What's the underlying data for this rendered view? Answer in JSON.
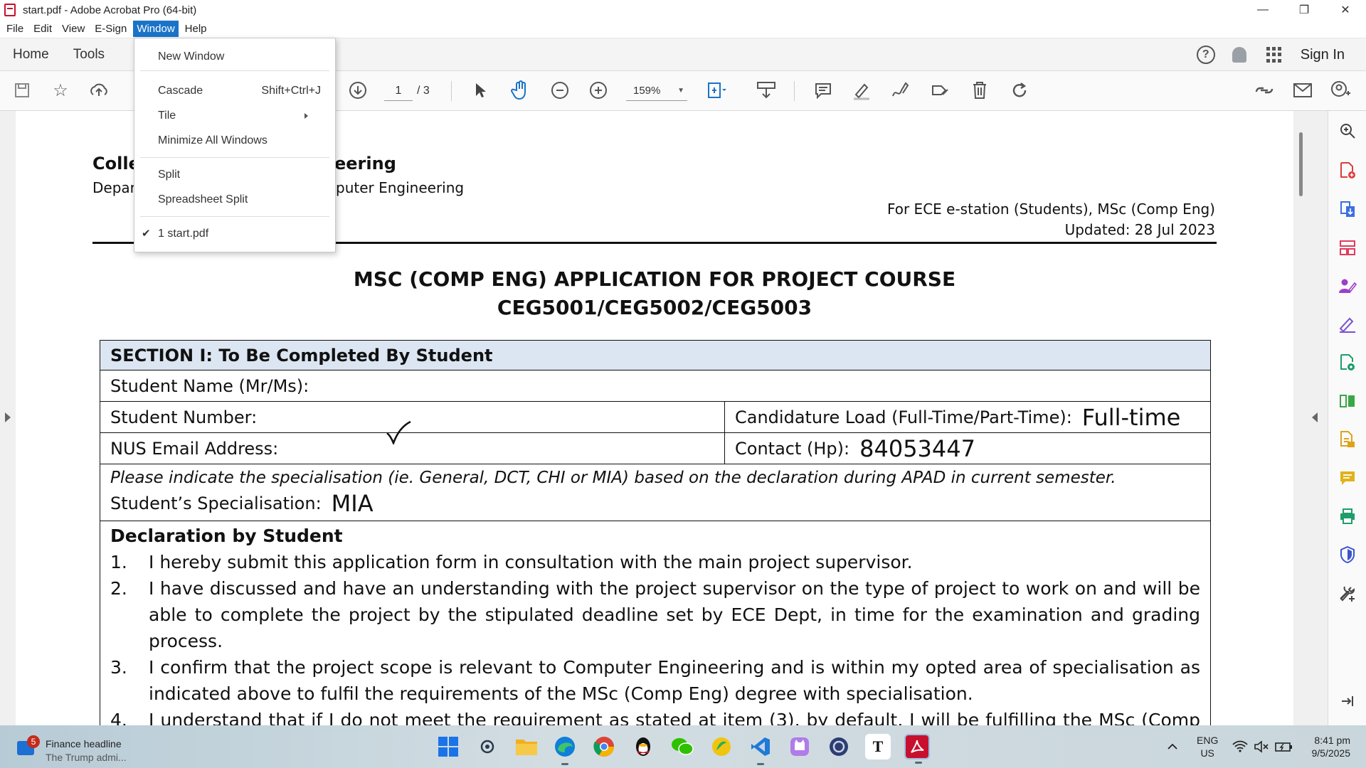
{
  "window": {
    "title": "start.pdf - Adobe Acrobat Pro (64-bit)",
    "controls": {
      "minimize": "—",
      "restore": "❐",
      "close": "✕"
    }
  },
  "menubar": [
    "File",
    "Edit",
    "View",
    "E-Sign",
    "Window",
    "Help"
  ],
  "active_menu": "Window",
  "window_menu": {
    "items": [
      {
        "label": "New Window",
        "shortcut": ""
      },
      {
        "label": "Cascade",
        "shortcut": "Shift+Ctrl+J"
      },
      {
        "label": "Tile",
        "shortcut": ""
      },
      {
        "label": "Minimize All Windows",
        "shortcut": ""
      },
      {
        "label": "Split",
        "shortcut": ""
      },
      {
        "label": "Spreadsheet Split",
        "shortcut": ""
      },
      {
        "label": "1 start.pdf",
        "shortcut": ""
      }
    ],
    "checked_item": "1 start.pdf"
  },
  "nav": {
    "home": "Home",
    "tools": "Tools",
    "sign_in": "Sign In",
    "help_symbol": "?"
  },
  "toolbar": {
    "page_current": "1",
    "page_total": "/ 3",
    "zoom": "159%"
  },
  "document": {
    "college_left": "Colle",
    "college_right": "eering",
    "dept_left": "Depar",
    "dept_right": "puter Engineering",
    "for_line": "For ECE e-station (Students), MSc (Comp Eng)",
    "updated_line": "Updated: 28 Jul 2023",
    "heading1": "MSC (COMP ENG) APPLICATION FOR PROJECT COURSE",
    "heading2": "CEG5001/CEG5002/CEG5003",
    "section_title": "SECTION I: To Be Completed By Student",
    "student_name_label": "Student Name (Mr/Ms):",
    "student_number_label": "Student Number:",
    "load_label": "Candidature Load (Full-Time/Part-Time):",
    "load_value": "Full-time",
    "email_label": "NUS Email Address:",
    "contact_label": "Contact (Hp):",
    "contact_value": "84053447",
    "spec_note": "Please indicate the specialisation (ie. General, DCT, CHI or MIA) based on the declaration during APAD in current semester.",
    "spec_label": "Student’s Specialisation:",
    "spec_value": "MIA",
    "declaration_title": "Declaration by Student",
    "declarations": [
      {
        "num": "1.",
        "text": "I hereby submit this application form in consultation with the main project supervisor."
      },
      {
        "num": "2.",
        "text": "I have discussed and have an understanding with the project supervisor on the type of project to work on and will be able to complete the project by the stipulated deadline set by ECE Dept, in time for the examination and grading process."
      },
      {
        "num": "3.",
        "text": "I confirm that the project scope is relevant to Computer Engineering and is within my opted area of specialisation as indicated above to fulfil the requirements of the MSc (Comp Eng) degree with specialisation."
      },
      {
        "num": "4.",
        "text": "I understand that if I do not meet the requirement as stated at item (3), by default, I will be fulfilling the MSc (Comp Eng) degree without specialisation."
      }
    ]
  },
  "taskbar": {
    "news_badge": "5",
    "news_title": "Finance headline",
    "news_sub": "The Trump admi...",
    "lang_top": "ENG",
    "lang_bottom": "US",
    "time": "8:41 pm",
    "date": "9/5/2025",
    "apps": [
      {
        "name": "windows-start",
        "color": "#1a73e8",
        "glyph": ""
      },
      {
        "name": "search",
        "color": "#3a4a5a",
        "glyph": ""
      },
      {
        "name": "file-explorer",
        "color": "#f2b01e",
        "glyph": ""
      },
      {
        "name": "edge",
        "color": "#0f7fd8",
        "glyph": ""
      },
      {
        "name": "chrome",
        "color": "#db4437",
        "glyph": ""
      },
      {
        "name": "qq",
        "color": "#111111",
        "glyph": ""
      },
      {
        "name": "wechat",
        "color": "#2dc100",
        "glyph": ""
      },
      {
        "name": "app-yellow",
        "color": "#f1c40f",
        "glyph": ""
      },
      {
        "name": "vscode",
        "color": "#1f7ad6",
        "glyph": ""
      },
      {
        "name": "app-cat",
        "color": "#b07ce8",
        "glyph": ""
      },
      {
        "name": "app-dark",
        "color": "#2c3e70",
        "glyph": ""
      },
      {
        "name": "typora",
        "color": "#ffffff",
        "glyph": "T"
      },
      {
        "name": "acrobat",
        "color": "#c8102e",
        "glyph": "A"
      }
    ]
  }
}
